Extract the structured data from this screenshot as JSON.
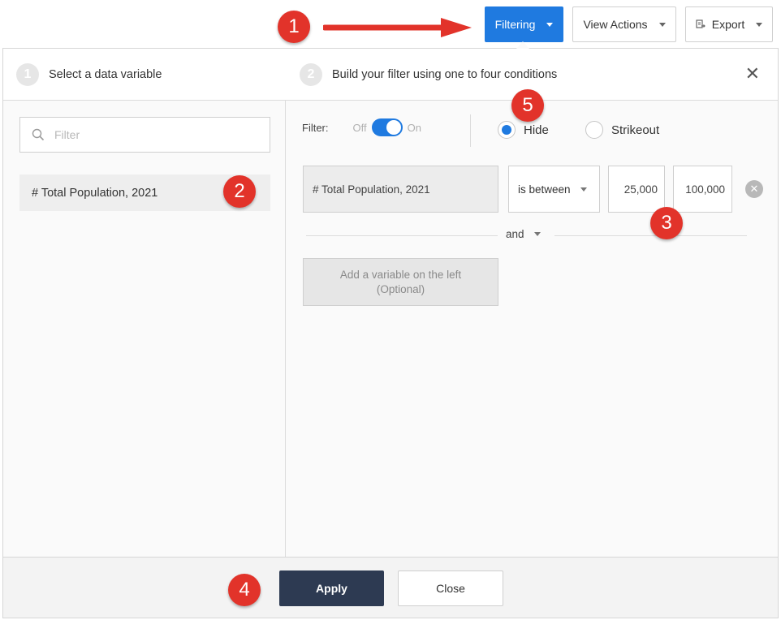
{
  "toolbar": {
    "filtering_label": "Filtering",
    "view_actions_label": "View Actions",
    "export_label": "Export",
    "export_icon": "export-file-icon"
  },
  "header": {
    "step1_num": "1",
    "step1_label": "Select a data variable",
    "step2_num": "2",
    "step2_label": "Build your filter using one to four conditions",
    "close_symbol": "✕"
  },
  "left": {
    "search_placeholder": "Filter",
    "variables": [
      "# Total Population, 2021"
    ]
  },
  "right": {
    "filter_label": "Filter:",
    "toggle_off": "Off",
    "toggle_on": "On",
    "toggle_state": "on",
    "mode_options": [
      "Hide",
      "Strikeout"
    ],
    "mode_selected": "Hide",
    "condition": {
      "variable": "# Total Population, 2021",
      "operator": "is between",
      "value_min": "25,000",
      "value_max": "100,000"
    },
    "conjunction": "and",
    "add_variable_line1": "Add a variable on the left",
    "add_variable_line2": "(Optional)"
  },
  "footer": {
    "apply_label": "Apply",
    "close_label": "Close"
  },
  "annotations": {
    "badges": [
      "1",
      "2",
      "3",
      "4",
      "5"
    ],
    "color": "#e2332a"
  },
  "colors": {
    "accent": "#1f7ae0",
    "apply_bg": "#2d3a52"
  }
}
